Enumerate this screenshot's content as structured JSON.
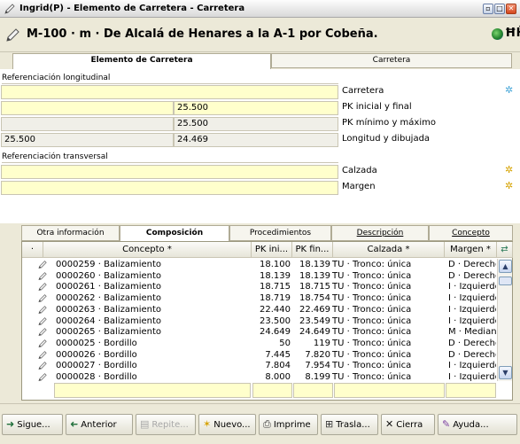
{
  "window": {
    "title": "Ingrid(P) - Elemento de Carretera - Carretera",
    "controls": {
      "minimize": "▫",
      "restore": "□",
      "close": "✕"
    }
  },
  "header": {
    "heading": "M-100 · m · De Alcalá de Henares a la A-1 por Cobeña.",
    "binoculars": "ĦĤ"
  },
  "top_tabs": [
    "Elemento de Carretera",
    "Carretera"
  ],
  "longitudinal": {
    "section_label": "Referenciación longitudinal",
    "rows": [
      {
        "label": "Carretera",
        "left": "",
        "right": ""
      },
      {
        "label": "PK inicial y final",
        "left": "",
        "right": "25.500"
      },
      {
        "label": "PK mínimo y máximo",
        "left": "",
        "right": "25.500"
      },
      {
        "label": "Longitud y dibujada",
        "left": "25.500",
        "right": "24.469"
      }
    ]
  },
  "transversal": {
    "section_label": "Referenciación transversal",
    "rows": [
      {
        "label": "Calzada",
        "value": ""
      },
      {
        "label": "Margen",
        "value": ""
      }
    ]
  },
  "sub_tabs": [
    "Otra información",
    "Composición",
    "Procedimientos",
    "Descripción",
    "Concepto"
  ],
  "grid": {
    "columns": [
      "·",
      "Concepto *",
      "PK ini...",
      "PK fin...",
      "Calzada *",
      "Margen *"
    ],
    "rows": [
      [
        "0000259 · Balizamiento",
        "18.100",
        "18.139",
        "TU · Tronco: única",
        "D · Derecho"
      ],
      [
        "0000260 · Balizamiento",
        "18.139",
        "18.139",
        "TU · Tronco: única",
        "D · Derecho"
      ],
      [
        "0000261 · Balizamiento",
        "18.715",
        "18.715",
        "TU · Tronco: única",
        "I · Izquierdo"
      ],
      [
        "0000262 · Balizamiento",
        "18.719",
        "18.754",
        "TU · Tronco: única",
        "I · Izquierdo"
      ],
      [
        "0000263 · Balizamiento",
        "22.440",
        "22.469",
        "TU · Tronco: única",
        "I · Izquierdo"
      ],
      [
        "0000264 · Balizamiento",
        "23.500",
        "23.549",
        "TU · Tronco: única",
        "I · Izquierdo"
      ],
      [
        "0000265 · Balizamiento",
        "24.649",
        "24.649",
        "TU · Tronco: única",
        "M · Mediana"
      ],
      [
        "0000025 · Bordillo",
        "50",
        "119",
        "TU · Tronco: única",
        "D · Derecho"
      ],
      [
        "0000026 · Bordillo",
        "7.445",
        "7.820",
        "TU · Tronco: única",
        "D · Derecho"
      ],
      [
        "0000027 · Bordillo",
        "7.804",
        "7.954",
        "TU · Tronco: única",
        "I · Izquierdo"
      ],
      [
        "0000028 · Bordillo",
        "8.000",
        "8.199",
        "TU · Tronco: única",
        "I · Izquierdo"
      ]
    ]
  },
  "buttons": [
    {
      "label": "Sigue...",
      "icon": "➜",
      "color": "#1f6f3a",
      "enabled": true
    },
    {
      "label": "Anterior",
      "icon": "➜",
      "color": "#1f6f3a",
      "enabled": true
    },
    {
      "label": "Repite...",
      "icon": "▤",
      "color": "#a8a8a8",
      "enabled": false
    },
    {
      "label": "Nuevo...",
      "icon": "✶",
      "color": "#d6a300",
      "enabled": true
    },
    {
      "label": "Imprime",
      "icon": "⎙",
      "color": "#333333",
      "enabled": true
    },
    {
      "label": "Trasla...",
      "icon": "⊞",
      "color": "#333333",
      "enabled": true
    },
    {
      "label": "Cierra",
      "icon": "✕",
      "color": "#111111",
      "enabled": true
    },
    {
      "label": "Ayuda...",
      "icon": "✎",
      "color": "#7a3fa0",
      "enabled": true
    }
  ]
}
